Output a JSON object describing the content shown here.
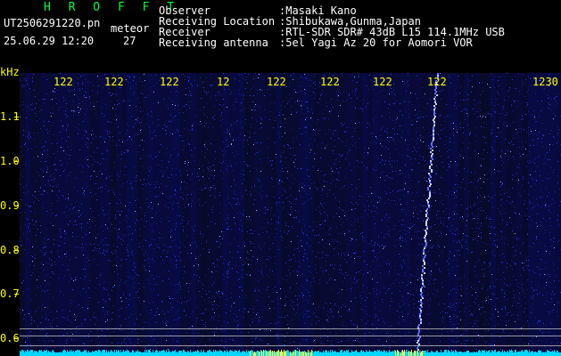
{
  "header": {
    "station_code": "H R O F F T",
    "file_name": "UT2506291220.pn",
    "object_type": "meteor",
    "date_time": "25.06.29 12:20",
    "count": "27",
    "fields": [
      {
        "label": "Observer",
        "value": ":Masaki Kano"
      },
      {
        "label": "Receiving Location",
        "value": ":Shibukawa,Gunma,Japan"
      },
      {
        "label": "Receiver",
        "value": ":RTL-SDR SDR# 43dB L15 114.1MHz USB"
      },
      {
        "label": "Receiving antenna",
        "value": ":5el Yagi Az 20 for Aomori VOR"
      }
    ]
  },
  "axis": {
    "unit": "kHz",
    "x_ticks": [
      "122",
      "122",
      "122",
      "12",
      "122",
      "122",
      "122",
      "122",
      "1230"
    ],
    "y_ticks": [
      "1.1",
      "1.0",
      "0.9",
      "0.8",
      "0.7",
      "0.6"
    ]
  },
  "colors": {
    "background": "#000000",
    "spectrum_bg": "#06063a",
    "noise": "#2a3cff",
    "text_white": "#ffffff",
    "text_green": "#00ff3c",
    "text_cyan": "#00e8ff",
    "tick_yellow": "#ffff00",
    "baseline_cyan": "#00d8ff"
  }
}
